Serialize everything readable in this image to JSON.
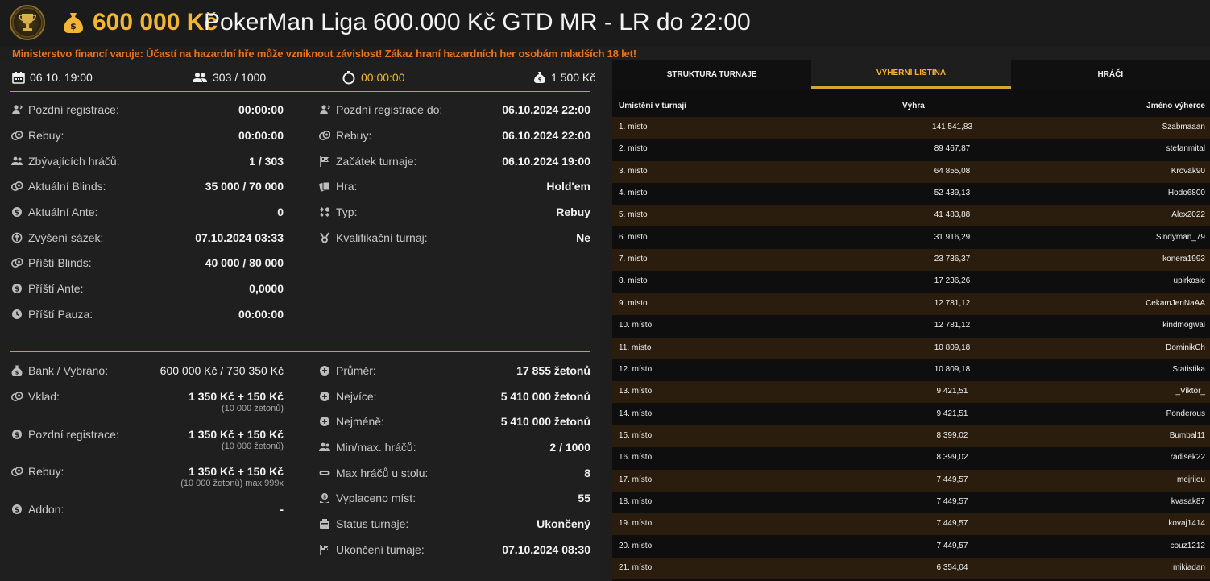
{
  "header": {
    "prize": "600 000 Kč",
    "title": "PokerMan Liga 600.000 Kč GTD MR - LR do 22:00"
  },
  "warning": "Ministerstvo financí varuje: Účastí na hazardní hře může vzniknout závislost! Zákaz hraní hazardních her osobám mladších 18 let!",
  "stats": {
    "date": "06.10. 19:00",
    "players": "303 / 1000",
    "timer": "00:00:00",
    "buyin": "1 500 Kč"
  },
  "info_left": [
    {
      "label": "Pozdní registrace:",
      "value": "00:00:00",
      "icon": "late-reg-icon"
    },
    {
      "label": "Rebuy:",
      "value": "00:00:00",
      "icon": "chips-icon"
    },
    {
      "label": "Zbývajících hráčů:",
      "value": "1 / 303",
      "icon": "users-icon"
    },
    {
      "label": "Aktuální Blinds:",
      "value": "35 000 / 70 000",
      "icon": "chips-icon"
    },
    {
      "label": "Aktuální Ante:",
      "value": "0",
      "icon": "coin-icon"
    },
    {
      "label": "Zvýšení sázek:",
      "value": "07.10.2024 03:33",
      "icon": "raise-icon"
    },
    {
      "label": "Příští Blinds:",
      "value": "40 000 / 80 000",
      "icon": "chips-icon"
    },
    {
      "label": "Příští Ante:",
      "value": "0,0000",
      "icon": "coin-icon"
    },
    {
      "label": "Příští Pauza:",
      "value": "00:00:00",
      "icon": "clock-icon"
    }
  ],
  "info_right": [
    {
      "label": "Pozdní registrace do:",
      "value": "06.10.2024 22:00",
      "icon": "late-reg-icon"
    },
    {
      "label": "Rebuy:",
      "value": "06.10.2024 22:00",
      "icon": "chips-icon"
    },
    {
      "label": "Začátek turnaje:",
      "value": "06.10.2024 19:00",
      "icon": "flag-icon"
    },
    {
      "label": "Hra:",
      "value": "Hold'em",
      "icon": "cards-icon"
    },
    {
      "label": "Typ:",
      "value": "Rebuy",
      "icon": "type-icon"
    },
    {
      "label": "Kvalifikační turnaj:",
      "value": "Ne",
      "icon": "medal-icon"
    }
  ],
  "money_left": [
    {
      "label": "Bank / Vybráno:",
      "value": "600 000 Kč / 730 350 Kč",
      "sub": "",
      "icon": "moneybag-icon",
      "gold": true
    },
    {
      "label": "Vklad:",
      "value": "1 350 Kč + 150 Kč",
      "sub": "(10 000 žetonů)",
      "icon": "chips-icon"
    },
    {
      "label": "Pozdní registrace:",
      "value": "1 350 Kč + 150 Kč",
      "sub": "(10 000 žetonů)",
      "icon": "coin-icon"
    },
    {
      "label": "Rebuy:",
      "value": "1 350 Kč + 150 Kč",
      "sub": "(10 000 žetonů) max 999x",
      "icon": "chips-icon"
    },
    {
      "label": "Addon:",
      "value": "-",
      "sub": "",
      "icon": "coin-icon"
    }
  ],
  "money_right": [
    {
      "label": "Průměr:",
      "value": "17 855 žetonů",
      "icon": "plus-circle-icon"
    },
    {
      "label": "Nejvíce:",
      "value": "5 410 000 žetonů",
      "icon": "plus-circle-icon"
    },
    {
      "label": "Nejméně:",
      "value": "5 410 000 žetonů",
      "icon": "plus-circle-icon"
    },
    {
      "label": "Min/max. hráčů:",
      "value": "2 / 1000",
      "icon": "users-icon"
    },
    {
      "label": "Max hráčů u stolu:",
      "value": "8",
      "icon": "table-icon"
    },
    {
      "label": "Vyplaceno míst:",
      "value": "55",
      "icon": "payout-icon"
    },
    {
      "label": "Status turnaje:",
      "value": "Ukončený",
      "icon": "status-icon"
    },
    {
      "label": "Ukončení turnaje:",
      "value": "07.10.2024 08:30",
      "icon": "flag-icon"
    }
  ],
  "tabs": [
    "STRUKTURA TURNAJE",
    "VÝHERNÍ LISTINA",
    "HRÁČI"
  ],
  "payout_table": {
    "headers": [
      "Umístění v turnaji",
      "Výhra",
      "Jméno výherce"
    ],
    "rows": [
      [
        "1. místo",
        "141 541,83",
        "Szabmaaan"
      ],
      [
        "2. místo",
        "89 467,87",
        "stefanmital"
      ],
      [
        "3. místo",
        "64 855,08",
        "Krovak90"
      ],
      [
        "4. místo",
        "52 439,13",
        "Hodo6800"
      ],
      [
        "5. místo",
        "41 483,88",
        "Alex2022"
      ],
      [
        "6. místo",
        "31 916,29",
        "Sindyman_79"
      ],
      [
        "7. místo",
        "23 736,37",
        "konera1993"
      ],
      [
        "8. místo",
        "17 236,26",
        "upirkosic"
      ],
      [
        "9. místo",
        "12 781,12",
        "CekamJenNaAA"
      ],
      [
        "10. místo",
        "12 781,12",
        "kindmogwai"
      ],
      [
        "11. místo",
        "10 809,18",
        "DominikCh"
      ],
      [
        "12. místo",
        "10 809,18",
        "Statistika"
      ],
      [
        "13. místo",
        "9 421,51",
        "_Viktor_"
      ],
      [
        "14. místo",
        "9 421,51",
        "Ponderous"
      ],
      [
        "15. místo",
        "8 399,02",
        "Bumbal11"
      ],
      [
        "16. místo",
        "8 399,02",
        "radisek22"
      ],
      [
        "17. místo",
        "7 449,57",
        "mejrijou"
      ],
      [
        "18. místo",
        "7 449,57",
        "kvasak87"
      ],
      [
        "19. místo",
        "7 449,57",
        "kovaj1414"
      ],
      [
        "20. místo",
        "7 449,57",
        "couz1212"
      ],
      [
        "21. místo",
        "6 354,04",
        "mikiadan"
      ]
    ]
  },
  "colors": {
    "accent": "#f2b632",
    "warning": "#e8731e",
    "row_highlight": "#2a1d0d"
  }
}
